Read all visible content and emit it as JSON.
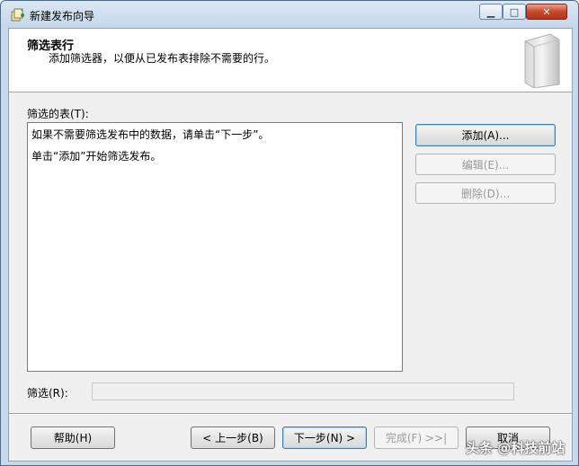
{
  "window": {
    "title": "新建发布向导"
  },
  "titlebar_buttons": {
    "minimize": "▁",
    "maximize": "□",
    "close": "✕"
  },
  "header": {
    "title": "筛选表行",
    "subtitle": "添加筛选器，以便从已发布表排除不需要的行。"
  },
  "filtered_tables": {
    "label": "筛选的表(T):",
    "lines": [
      "如果不需要筛选发布中的数据，请单击“下一步”。",
      "单击“添加”开始筛选发布。"
    ]
  },
  "side_buttons": {
    "add": "添加(A)...",
    "edit": "编辑(E)...",
    "delete": "删除(D)..."
  },
  "filter": {
    "label": "筛选(R):",
    "value": ""
  },
  "footer_buttons": {
    "help": "帮助(H)",
    "back": "< 上一步(B)",
    "next": "下一步(N) >",
    "finish": "完成(F) >>|",
    "cancel": "取消"
  },
  "watermark": "头条 @科技前站"
}
